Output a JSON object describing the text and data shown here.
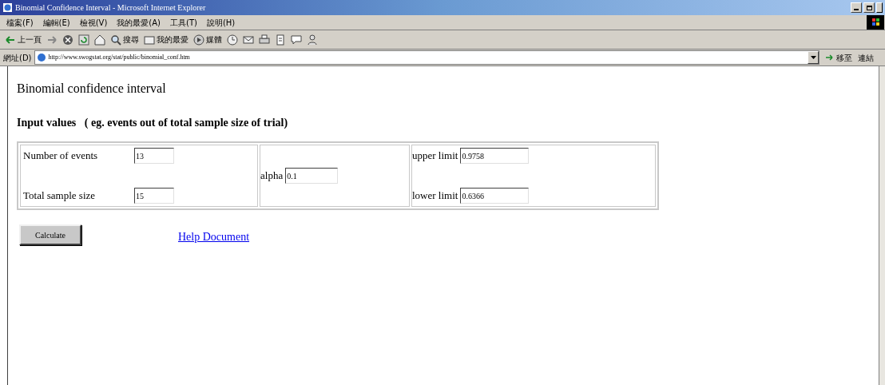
{
  "window": {
    "title": "Binomial Confidence Interval - Microsoft Internet Explorer"
  },
  "menu": [
    {
      "label": "檔案(F)"
    },
    {
      "label": "編輯(E)"
    },
    {
      "label": "檢視(V)"
    },
    {
      "label": "我的最愛(A)"
    },
    {
      "label": "工具(T)"
    },
    {
      "label": "說明(H)"
    }
  ],
  "toolbar": [
    {
      "kind": "back",
      "label": "上一頁"
    },
    {
      "kind": "forward"
    },
    {
      "kind": "stop"
    },
    {
      "kind": "refresh"
    },
    {
      "kind": "home"
    },
    {
      "kind": "search",
      "label": "搜尋"
    },
    {
      "kind": "favorites",
      "label": "我的最愛"
    },
    {
      "kind": "media",
      "label": "媒體"
    },
    {
      "kind": "history"
    },
    {
      "kind": "mail"
    },
    {
      "kind": "print"
    },
    {
      "kind": "edit"
    },
    {
      "kind": "discuss"
    },
    {
      "kind": "messenger"
    }
  ],
  "address_bar": {
    "label": "網址(D)",
    "url": "http://www.swogstat.org/stat/public/binomial_conf.htm",
    "go": "移至",
    "links": "連結"
  },
  "page": {
    "heading": "Binomial confidence interval",
    "subheading": "Input values   ( eg. events out of total sample size of trial)",
    "fields": [
      {
        "label": "Number of events",
        "value": "13"
      },
      {
        "label": "Total sample size",
        "value": "15"
      },
      {
        "label": "alpha",
        "value": "0.1"
      },
      {
        "label": "upper limit",
        "value": "0.9758"
      },
      {
        "label": "lower limit",
        "value": "0.6366"
      }
    ],
    "button": "Calculate",
    "link": "Help Document"
  }
}
